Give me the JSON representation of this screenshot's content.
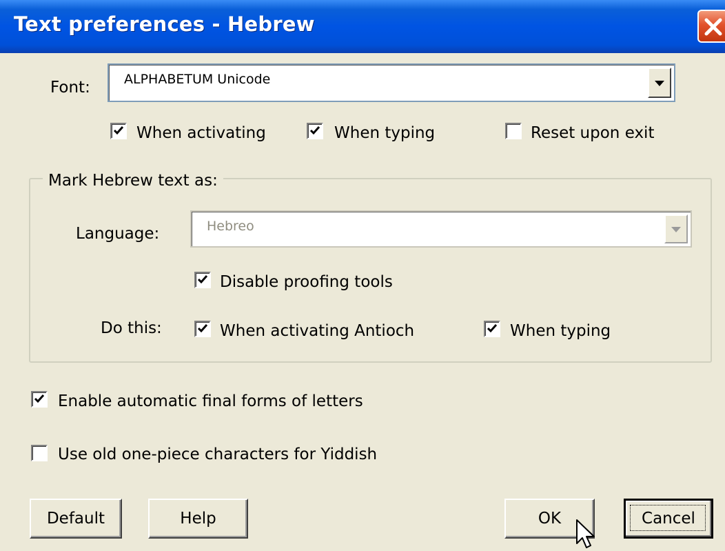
{
  "window": {
    "title": "Text preferences - Hebrew",
    "close_icon": "close-icon"
  },
  "font": {
    "label": "Font:",
    "selected": "ALPHABETUM Unicode",
    "options": {
      "when_activating": {
        "label": "When activating",
        "checked": true
      },
      "when_typing": {
        "label": "When typing",
        "checked": true
      },
      "reset_upon_exit": {
        "label": "Reset upon exit",
        "checked": false
      }
    }
  },
  "mark_group": {
    "legend": "Mark Hebrew text as:",
    "language_label": "Language:",
    "language_value": "Hebreo",
    "language_enabled": false,
    "disable_proofing": {
      "label": "Disable proofing tools",
      "checked": true
    },
    "do_this_label": "Do this:",
    "when_activating_antioch": {
      "label": "When activating Antioch",
      "checked": true
    },
    "when_typing": {
      "label": "When typing",
      "checked": true
    }
  },
  "options": {
    "final_forms": {
      "label": "Enable automatic final forms of letters",
      "checked": true
    },
    "yiddish": {
      "label": "Use old one-piece characters for Yiddish",
      "checked": false
    }
  },
  "buttons": {
    "default": "Default",
    "help": "Help",
    "ok": "OK",
    "cancel": "Cancel"
  },
  "colors": {
    "title_bar": "#0054e3",
    "dialog_bg": "#ece9d8",
    "close_button": "#e2522d"
  }
}
